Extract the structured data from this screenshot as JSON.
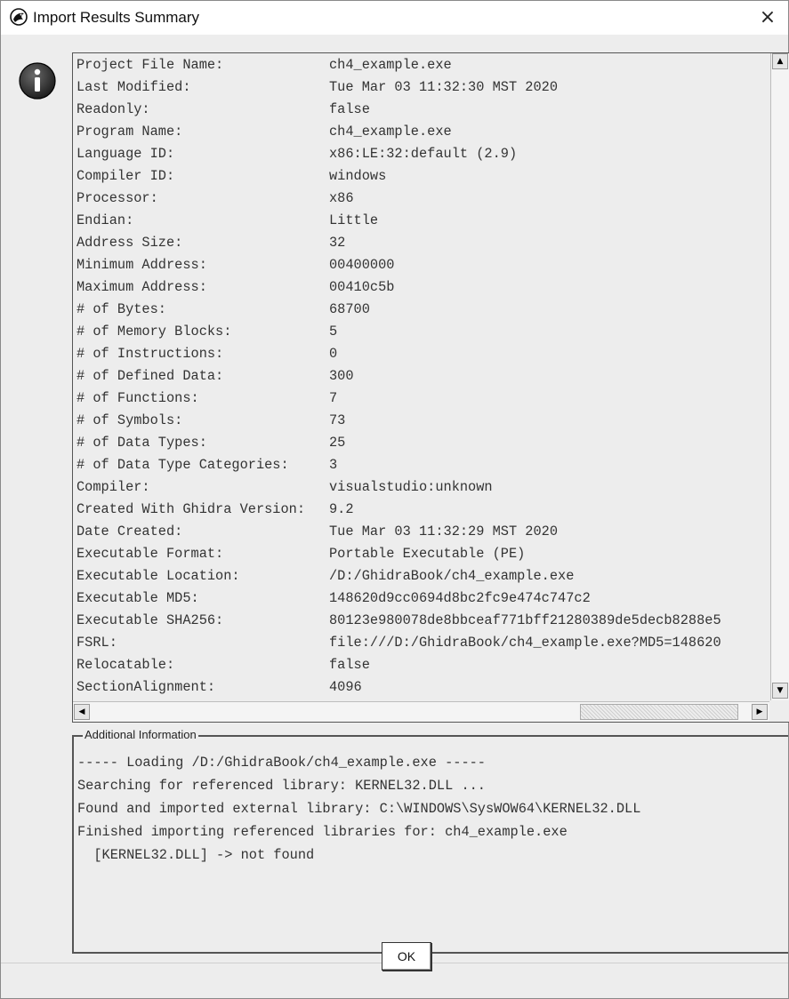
{
  "window": {
    "title": "Import Results Summary",
    "close_glyph": "×",
    "title_icon": "ghidra-dragon-icon",
    "info_icon": "info-icon"
  },
  "summary": {
    "rows": [
      {
        "key": "Project File Name:",
        "value": "ch4_example.exe"
      },
      {
        "key": "Last Modified:",
        "value": "Tue Mar 03 11:32:30 MST 2020"
      },
      {
        "key": "Readonly:",
        "value": "false"
      },
      {
        "key": "Program Name:",
        "value": "ch4_example.exe"
      },
      {
        "key": "Language ID:",
        "value": "x86:LE:32:default (2.9)"
      },
      {
        "key": "Compiler ID:",
        "value": "windows"
      },
      {
        "key": "Processor:",
        "value": "x86"
      },
      {
        "key": "Endian:",
        "value": "Little"
      },
      {
        "key": "Address Size:",
        "value": "32"
      },
      {
        "key": "Minimum Address:",
        "value": "00400000"
      },
      {
        "key": "Maximum Address:",
        "value": "00410c5b"
      },
      {
        "key": "# of Bytes:",
        "value": "68700"
      },
      {
        "key": "# of Memory Blocks:",
        "value": "5"
      },
      {
        "key": "# of Instructions:",
        "value": "0"
      },
      {
        "key": "# of Defined Data:",
        "value": "300"
      },
      {
        "key": "# of Functions:",
        "value": "7"
      },
      {
        "key": "# of Symbols:",
        "value": "73"
      },
      {
        "key": "# of Data Types:",
        "value": "25"
      },
      {
        "key": "# of Data Type Categories:",
        "value": "3"
      },
      {
        "key": "Compiler:",
        "value": "visualstudio:unknown"
      },
      {
        "key": "Created With Ghidra Version:",
        "value": "9.2"
      },
      {
        "key": "Date Created:",
        "value": "Tue Mar 03 11:32:29 MST 2020"
      },
      {
        "key": "Executable Format:",
        "value": "Portable Executable (PE)"
      },
      {
        "key": "Executable Location:",
        "value": "/D:/GhidraBook/ch4_example.exe"
      },
      {
        "key": "Executable MD5:",
        "value": "148620d9cc0694d8bc2fc9e474c747c2"
      },
      {
        "key": "Executable SHA256:",
        "value": "80123e980078de8bbceaf771bff21280389de5decb8288e5"
      },
      {
        "key": "FSRL:",
        "value": "file:///D:/GhidraBook/ch4_example.exe?MD5=148620"
      },
      {
        "key": "Relocatable:",
        "value": "false"
      },
      {
        "key": "SectionAlignment:",
        "value": "4096"
      }
    ]
  },
  "additional": {
    "legend": "Additional Information",
    "lines": [
      "----- Loading /D:/GhidraBook/ch4_example.exe -----",
      "Searching for referenced library: KERNEL32.DLL ...",
      "Found and imported external library: C:\\WINDOWS\\SysWOW64\\KERNEL32.DLL",
      "Finished importing referenced libraries for: ch4_example.exe",
      "  [KERNEL32.DLL] -> not found"
    ]
  },
  "buttons": {
    "ok_label": "OK"
  },
  "scroll": {
    "up_glyph": "▲",
    "down_glyph": "▼",
    "left_glyph": "◀",
    "right_glyph": "▶"
  }
}
